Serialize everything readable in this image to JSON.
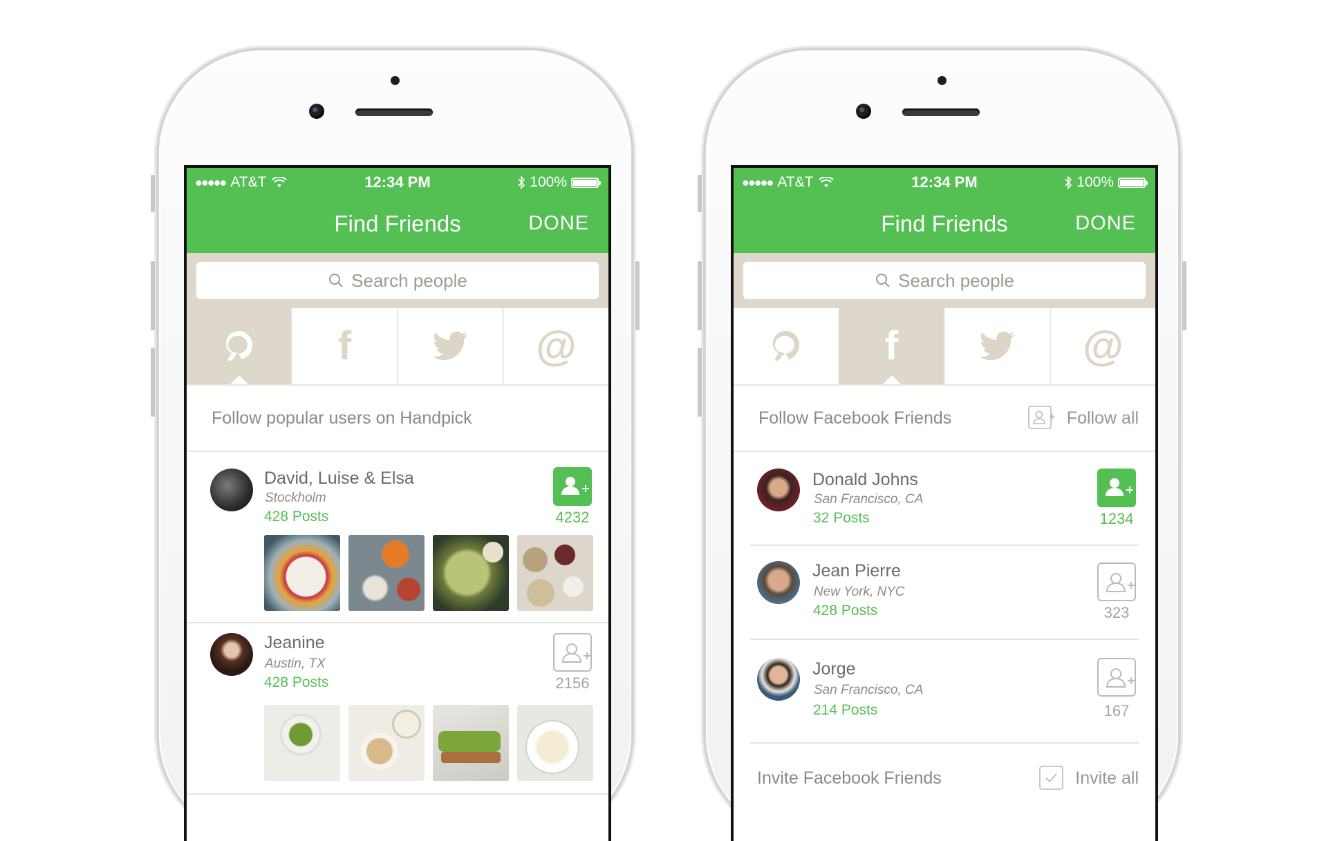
{
  "status_bar": {
    "carrier": "AT&T",
    "time": "12:34 PM",
    "battery": "100%"
  },
  "nav": {
    "title": "Find Friends",
    "done": "DONE"
  },
  "search": {
    "placeholder": "Search people"
  },
  "tabs": [
    {
      "id": "handpick",
      "icon": "handpick-logo-icon"
    },
    {
      "id": "facebook",
      "icon": "facebook-icon",
      "glyph": "f"
    },
    {
      "id": "twitter",
      "icon": "twitter-bird-icon"
    },
    {
      "id": "email",
      "icon": "at-sign-icon",
      "glyph": "@"
    }
  ],
  "left_screen": {
    "active_tab": "handpick",
    "section_title": "Follow popular users on Handpick",
    "users": [
      {
        "name": "David, Luise & Elsa",
        "location": "Stockholm",
        "posts": "428 Posts",
        "followers": "4232",
        "following": true
      },
      {
        "name": "Jeanine",
        "location": "Austin, TX",
        "posts": "428 Posts",
        "followers": "2156",
        "following": false
      }
    ]
  },
  "right_screen": {
    "active_tab": "facebook",
    "section_title": "Follow Facebook Friends",
    "section_action": "Follow all",
    "users": [
      {
        "name": "Donald Johns",
        "location": "San Francisco, CA",
        "posts": "32 Posts",
        "followers": "1234",
        "following": true
      },
      {
        "name": "Jean Pierre",
        "location": "New York, NYC",
        "posts": "428 Posts",
        "followers": "323",
        "following": false
      },
      {
        "name": "Jorge",
        "location": "San Francisco, CA",
        "posts": "214 Posts",
        "followers": "167",
        "following": false
      }
    ],
    "invite_title": "Invite Facebook Friends",
    "invite_action": "Invite all"
  },
  "colors": {
    "accent": "#54bf53",
    "beige": "#ddd8cb",
    "text_gray": "#6d6a64"
  }
}
